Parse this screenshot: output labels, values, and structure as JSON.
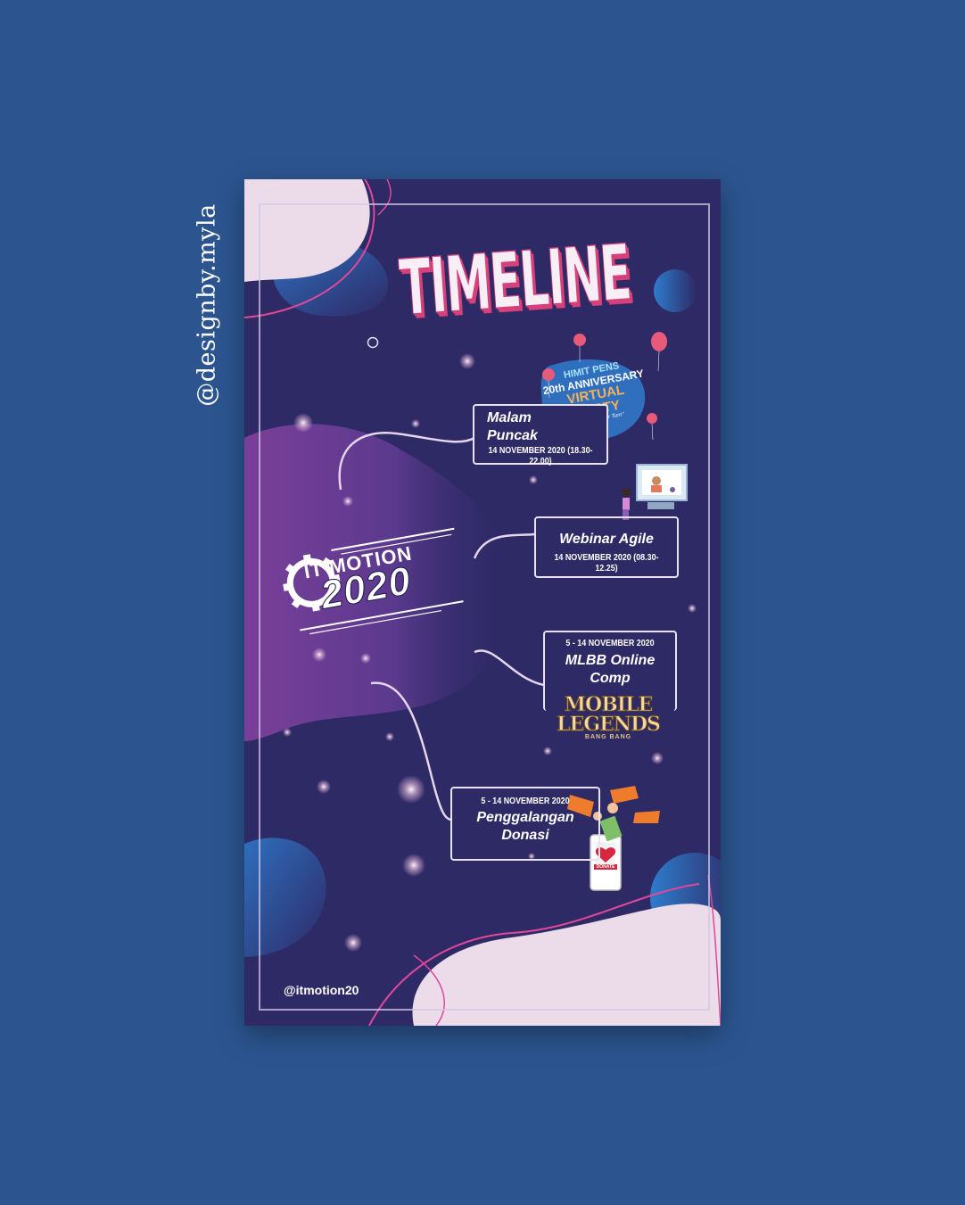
{
  "watermark": "@designby.myla",
  "poster": {
    "title": "TIMELINE",
    "handle": "@itmotion20",
    "logo": {
      "line1": "IT MOTION",
      "line2": "2020"
    },
    "badge": {
      "line1": "HIMIT PENS",
      "line2": "20th ANNIVERSARY",
      "line3": "VIRTUAL",
      "line4": "PARTY",
      "line5": "\"Now IT's Your Turn\""
    },
    "mlbb_logo": {
      "line1": "MOBILE",
      "line2": "LEGENDS",
      "line3": "BANG BANG"
    },
    "donate_label": "DONATE",
    "events": [
      {
        "name_line1": "Malam",
        "name_line2": "Puncak",
        "date": "14 NOVEMBER 2020 (18.30-22.00)"
      },
      {
        "name_line1": "Webinar Agile",
        "name_line2": "",
        "date": "14 NOVEMBER 2020 (08.30-12.25)"
      },
      {
        "name_line1": "MLBB Online",
        "name_line2": "Comp",
        "date": "5 - 14 NOVEMBER 2020"
      },
      {
        "name_line1": "Penggalangan",
        "name_line2": "Donasi",
        "date": "5 - 14 NOVEMBER 2020"
      }
    ]
  },
  "colors": {
    "page_bg": "#2c5590",
    "poster_bg": "#2e2a66",
    "accent_pink": "#d7417a",
    "blob_light": "#ecdce9",
    "blob_purple": "#7b3f9a",
    "blob_blue": "#2f6bb6"
  }
}
